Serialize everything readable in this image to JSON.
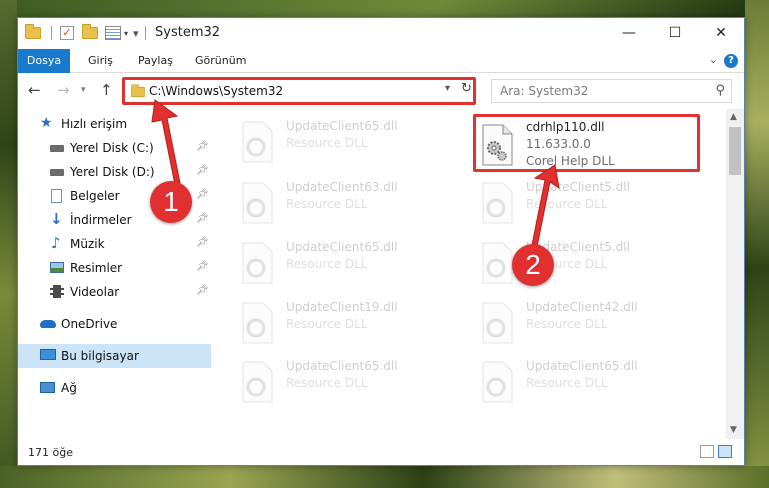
{
  "window": {
    "title": "System32",
    "controls": {
      "minimize": "—",
      "maximize": "☐",
      "close": "✕"
    }
  },
  "ribbon": {
    "tabs": [
      "Dosya",
      "Giriş",
      "Paylaş",
      "Görünüm"
    ],
    "help": "?"
  },
  "address": {
    "path": "C:\\Windows\\System32",
    "search_placeholder": "Ara: System32"
  },
  "sidebar": {
    "items": [
      {
        "label": "Hızlı erişim",
        "icon": "star-icon",
        "pinned": false
      },
      {
        "label": "Yerel Disk (C:)",
        "icon": "drive-icon",
        "pinned": true
      },
      {
        "label": "Yerel Disk (D:)",
        "icon": "drive-icon",
        "pinned": true
      },
      {
        "label": "Belgeler",
        "icon": "documents-icon",
        "pinned": true
      },
      {
        "label": "İndirmeler",
        "icon": "download-icon",
        "pinned": true
      },
      {
        "label": "Müzik",
        "icon": "music-icon",
        "pinned": true
      },
      {
        "label": "Resimler",
        "icon": "pictures-icon",
        "pinned": true
      },
      {
        "label": "Videolar",
        "icon": "videos-icon",
        "pinned": true
      },
      {
        "label": "OneDrive",
        "icon": "cloud-icon",
        "pinned": false
      },
      {
        "label": "Bu bilgisayar",
        "icon": "computer-icon",
        "pinned": false,
        "selected": true
      },
      {
        "label": "Ağ",
        "icon": "network-icon",
        "pinned": false
      }
    ]
  },
  "files": {
    "left": [
      {
        "name": "UpdateClient65.dll",
        "desc": "Resource DLL"
      },
      {
        "name": "UpdateClient63.dll",
        "desc": "Resource DLL"
      },
      {
        "name": "UpdateClient65.dll",
        "desc": "Resource DLL"
      },
      {
        "name": "UpdateClient19.dll",
        "desc": "Resource DLL"
      },
      {
        "name": "UpdateClient65.dll",
        "desc": "Resource DLL"
      }
    ],
    "right": [
      {
        "name": "cdrhlp110.dll",
        "version": "11.633.0.0",
        "desc": "Corel Help DLL",
        "highlighted": true
      },
      {
        "name": "UpdateClient5.dll",
        "desc": "Resource DLL"
      },
      {
        "name": "UpdateClient5.dll",
        "desc": "Resource DLL"
      },
      {
        "name": "UpdateClient42.dll",
        "desc": "Resource DLL"
      },
      {
        "name": "UpdateClient65.dll",
        "desc": "Resource DLL"
      }
    ]
  },
  "status": {
    "count": "171 öğe"
  },
  "callouts": [
    "1",
    "2"
  ],
  "colors": {
    "accent": "#1979ca",
    "highlight": "#e0302f",
    "selected": "#cce4f7"
  }
}
